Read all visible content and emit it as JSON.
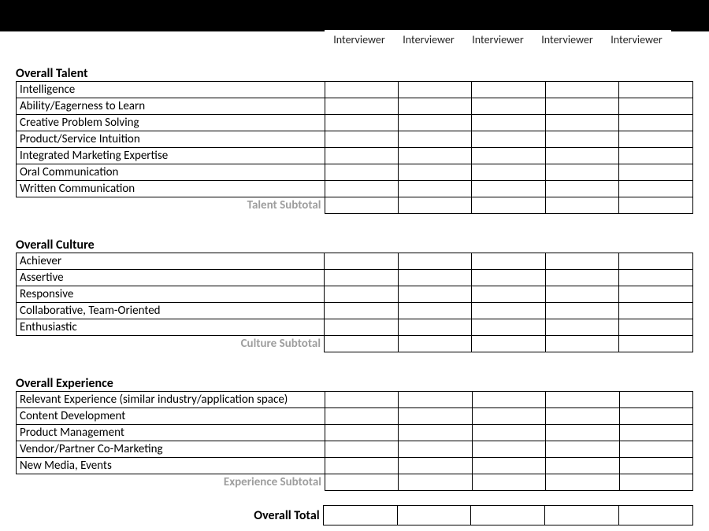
{
  "columns": [
    "Interviewer",
    "Interviewer",
    "Interviewer",
    "Interviewer",
    "Interviewer"
  ],
  "sections": [
    {
      "title": "Overall Talent",
      "rows": [
        "Intelligence",
        "Ability/Eagerness to Learn",
        "Creative Problem Solving",
        "Product/Service Intuition",
        "Integrated Marketing Expertise",
        "Oral Communication",
        "Written Communication"
      ],
      "subtotal_label": "Talent Subtotal"
    },
    {
      "title": "Overall Culture",
      "rows": [
        "Achiever",
        "Assertive",
        "Responsive",
        "Collaborative, Team-Oriented",
        "Enthusiastic"
      ],
      "subtotal_label": "Culture Subtotal"
    },
    {
      "title": "Overall Experience",
      "rows": [
        "Relevant Experience (similar industry/application space)",
        "Content Development",
        "Product Management",
        "Vendor/Partner Co-Marketing",
        "New Media, Events"
      ],
      "subtotal_label": "Experience Subtotal"
    }
  ],
  "overall_total_label": "Overall Total"
}
